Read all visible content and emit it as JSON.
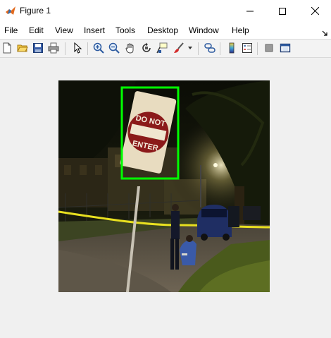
{
  "window": {
    "title": "Figure 1"
  },
  "menu": {
    "items": [
      "File",
      "Edit",
      "View",
      "Insert",
      "Tools",
      "Desktop",
      "Window",
      "Help"
    ]
  },
  "toolbar": {
    "buttons": [
      "new-figure-icon",
      "open-file-icon",
      "save-icon",
      "print-icon",
      "select-arrow-icon",
      "zoom-in-icon",
      "zoom-out-icon",
      "pan-hand-icon",
      "rotate-3d-icon",
      "data-cursor-icon",
      "brush-icon",
      "link-plot-icon",
      "colorbar-icon",
      "legend-icon",
      "hide-plot-tools-icon",
      "show-plot-tools-icon"
    ]
  },
  "sign": {
    "line1": "DO NOT",
    "line2": "ENTER"
  },
  "colors": {
    "detection_box": "#00ff00",
    "sign_red": "#8b1a1a",
    "tape_yellow": "#e8e020"
  }
}
